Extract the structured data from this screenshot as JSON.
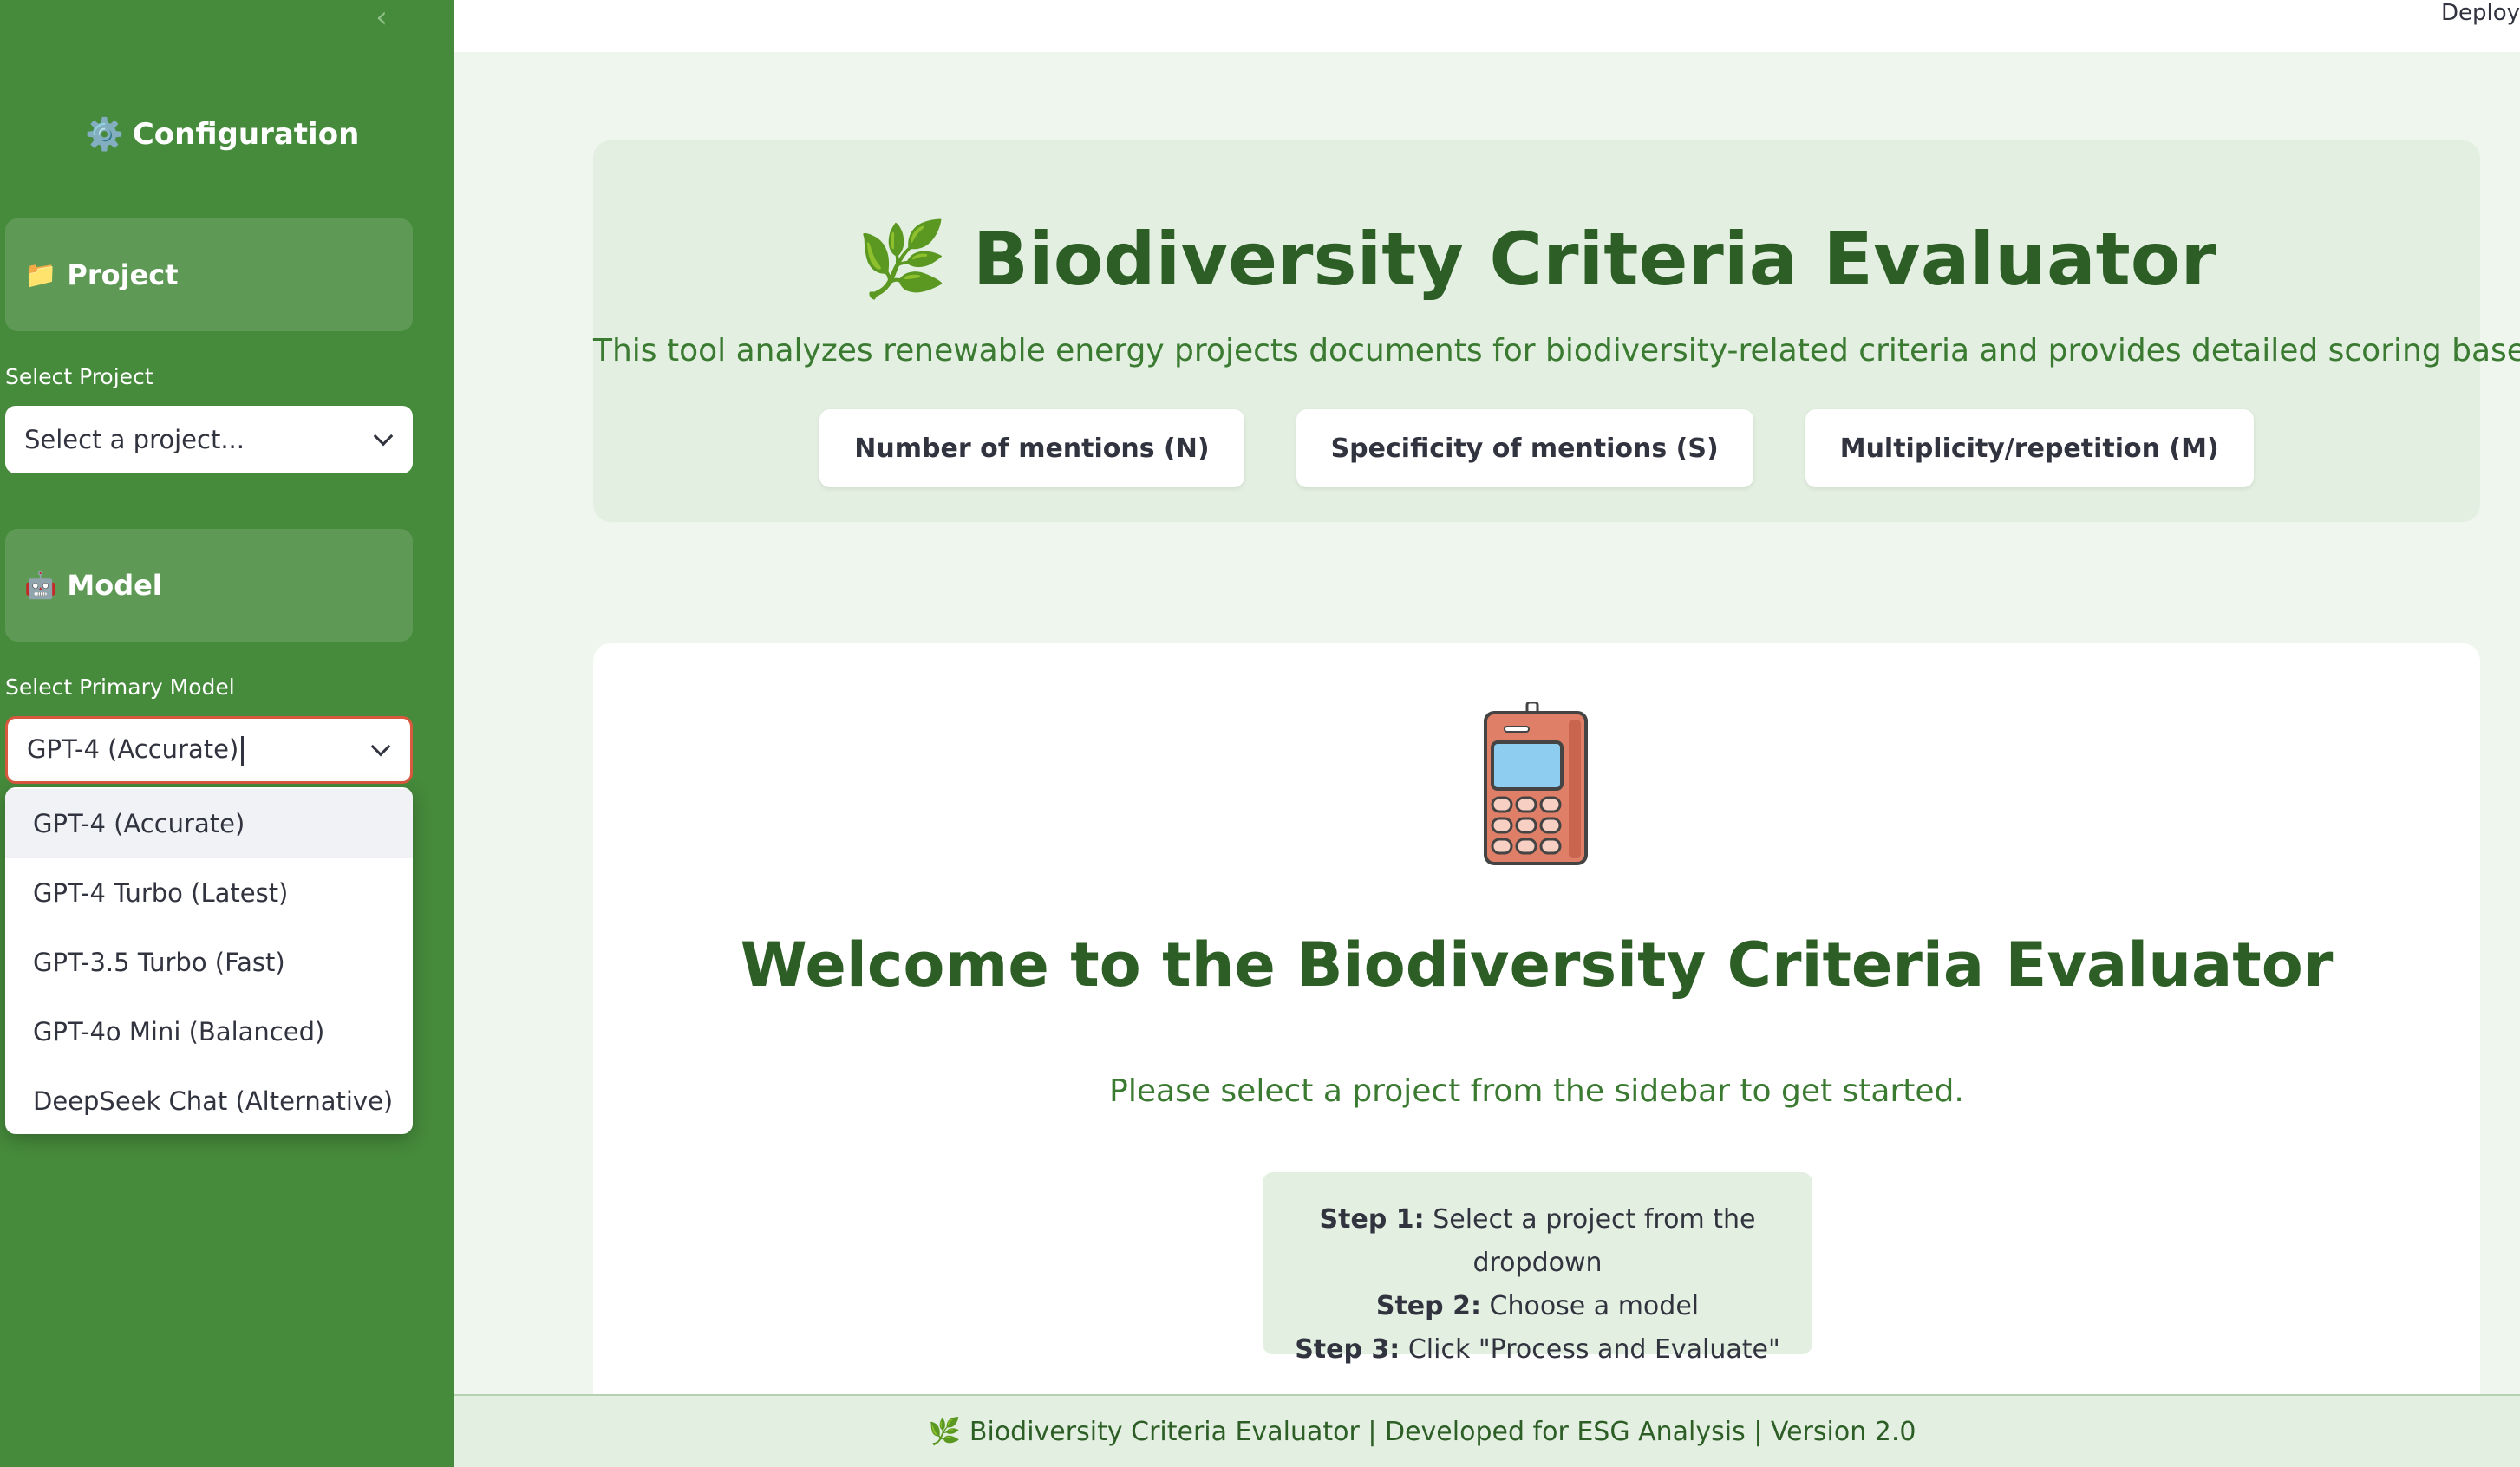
{
  "header": {
    "deploy_label": "Deploy"
  },
  "sidebar": {
    "collapse_icon": "chevron-left-icon",
    "title": "Configuration",
    "title_icon": "⚙️",
    "project_section": {
      "label": "Project",
      "icon": "📁"
    },
    "project_select": {
      "label": "Select Project",
      "placeholder": "Select a project..."
    },
    "model_section": {
      "label": "Model",
      "icon": "🤖"
    },
    "model_select": {
      "label": "Select Primary Model",
      "value": "GPT-4 (Accurate)",
      "options": [
        "GPT-4 (Accurate)",
        "GPT-4 Turbo (Latest)",
        "GPT-3.5 Turbo (Fast)",
        "GPT-4o Mini (Balanced)",
        "DeepSeek Chat (Alternative)"
      ]
    }
  },
  "hero": {
    "icon": "🌿",
    "title": "Biodiversity Criteria Evaluator",
    "subtitle": "This tool analyzes renewable energy projects documents for biodiversity-related criteria and provides detailed scoring based on:",
    "criteria": [
      "Number of mentions (N)",
      "Specificity of mentions (S)",
      "Multiplicity/repetition (M)"
    ]
  },
  "welcome": {
    "icon": "mobile-phone-icon",
    "title": "Welcome to the Biodiversity Criteria Evaluator",
    "subtitle": "Please select a project from the sidebar to get started.",
    "steps": [
      {
        "label": "Step 1:",
        "text": "Select a project from the dropdown"
      },
      {
        "label": "Step 2:",
        "text": "Choose a model"
      },
      {
        "label": "Step 3:",
        "text": "Click \"Process and Evaluate\""
      }
    ]
  },
  "footer": {
    "icon": "🌿",
    "text": "Biodiversity Criteria Evaluator | Developed for ESG Analysis | Version 2.0"
  },
  "colors": {
    "sidebar_bg": "#468a3b",
    "section_bg": "#5e9a55",
    "main_bg": "#eef6ee",
    "card_bg": "#e3efe1",
    "heading_green": "#2c5e25",
    "focus_border": "#d9593f"
  }
}
